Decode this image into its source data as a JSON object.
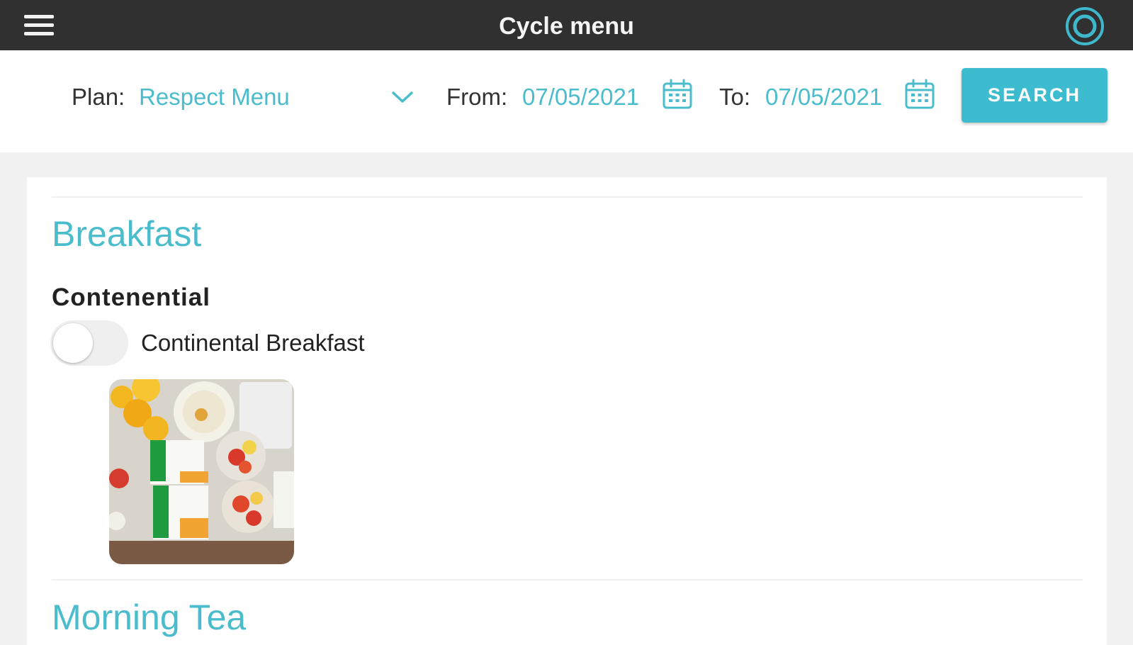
{
  "header": {
    "title": "Cycle menu",
    "accent_color": "#4bbccc",
    "background_color": "#303030",
    "menu_icon": "hamburger-menu-icon",
    "profile_icon": "profile-ring-icon"
  },
  "filters": {
    "plan_label": "Plan:",
    "plan_value": "Respect Menu",
    "from_label": "From:",
    "from_value": "07/05/2021",
    "to_label": "To:",
    "to_value": "07/05/2021",
    "search_label": "SEARCH",
    "calendar_icon": "calendar-icon",
    "dropdown_icon": "chevron-down-icon"
  },
  "menu": {
    "meals": [
      {
        "title": "Breakfast",
        "category": "Contenential",
        "item": "Continental Breakfast",
        "toggle_on": false
      },
      {
        "title": "Morning Tea"
      }
    ]
  }
}
